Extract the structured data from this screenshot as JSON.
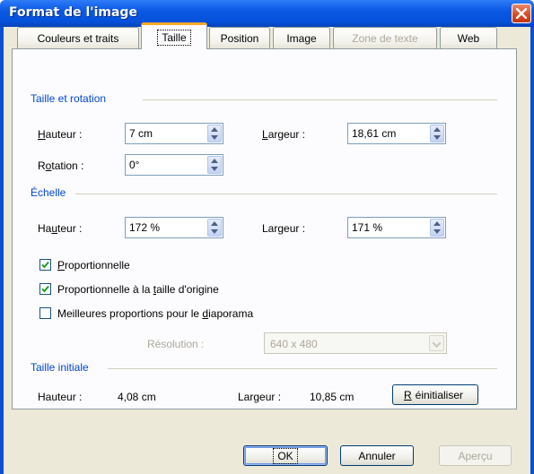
{
  "window": {
    "title": "Format de l'image"
  },
  "icons": {
    "close": "close-icon",
    "check": "checkmark-icon",
    "spin": "spin-arrows-icon",
    "dropdown": "chevron-down-icon"
  },
  "tabs": [
    {
      "label": "Couleurs et traits",
      "active": false,
      "enabled": true
    },
    {
      "label": "Taille",
      "active": true,
      "enabled": true
    },
    {
      "label": "Position",
      "active": false,
      "enabled": true
    },
    {
      "label": "Image",
      "active": false,
      "enabled": true
    },
    {
      "label": "Zone de texte",
      "active": false,
      "enabled": false
    },
    {
      "label": "Web",
      "active": false,
      "enabled": true
    }
  ],
  "size_rotation": {
    "title": "Taille et rotation",
    "height": {
      "label_pre": "",
      "label_ul": "H",
      "label_post": "auteur :",
      "value": "7 cm"
    },
    "width": {
      "label_pre": "",
      "label_ul": "L",
      "label_post": "argeur :",
      "value": "18,61 cm"
    },
    "rotation": {
      "label_pre": "R",
      "label_ul": "o",
      "label_post": "tation :",
      "value": "0°"
    }
  },
  "scale": {
    "title": "Échelle",
    "height": {
      "label_pre": "Ha",
      "label_ul": "u",
      "label_post": "teur :",
      "value": "172 %"
    },
    "width": {
      "label_pre": "Lar",
      "label_ul": "g",
      "label_post": "eur :",
      "value": "171 %"
    },
    "lock_aspect": {
      "label_pre": "",
      "label_ul": "P",
      "label_post": "roportionnelle",
      "checked": true
    },
    "relative_original": {
      "label_pre": "Proportionnelle à la ",
      "label_ul": "t",
      "label_post": "aille d'origine",
      "checked": true
    },
    "best_scale": {
      "label_pre": "Meilleures proportions pour le ",
      "label_ul": "d",
      "label_post": "iaporama",
      "checked": false
    },
    "resolution": {
      "label": "Résolution :",
      "value": "640 x 480",
      "enabled": false
    }
  },
  "original_size": {
    "title": "Taille initiale",
    "height_label": "Hauteur :",
    "height_value": "4,08 cm",
    "width_label": "Largeur :",
    "width_value": "10,85 cm",
    "reset_pre": "",
    "reset_ul": "R",
    "reset_post": "éinitialiser"
  },
  "footer": {
    "ok": "OK",
    "cancel": "Annuler",
    "preview": "Aperçu"
  },
  "colors": {
    "title_bar": "#0a58e4",
    "group_title": "#0046d5",
    "active_tab_accent": "#f7a92b",
    "dialog_bg": "#ece9d8"
  }
}
